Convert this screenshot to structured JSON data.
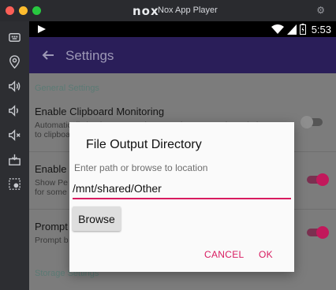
{
  "window": {
    "logo_text": "nox",
    "title": "Nox App Player"
  },
  "status_bar": {
    "time": "5:53"
  },
  "app_bar": {
    "title": "Settings"
  },
  "settings": {
    "general_header": "General Settings",
    "clipboard": {
      "title": "Enable Clipboard Monitoring",
      "summary_line1": "Automatically begin capture when a Periscope URL is copied",
      "summary_line2": "to clipboard",
      "enabled": false
    },
    "second": {
      "title": "Enable T",
      "summary_line1": "Show Pe",
      "summary_line2": "for some",
      "enabled": true
    },
    "third": {
      "title": "Prompt",
      "summary_line1": "Prompt b",
      "enabled": true
    },
    "storage_header": "Storage Settings"
  },
  "dialog": {
    "title": "File Output Directory",
    "hint": "Enter path or browse to location",
    "path_value": "/mnt/shared/Other",
    "browse_label": "Browse",
    "cancel_label": "CANCEL",
    "ok_label": "OK"
  },
  "colors": {
    "accent": "#d81b60",
    "appbar": "#2a1e59"
  }
}
